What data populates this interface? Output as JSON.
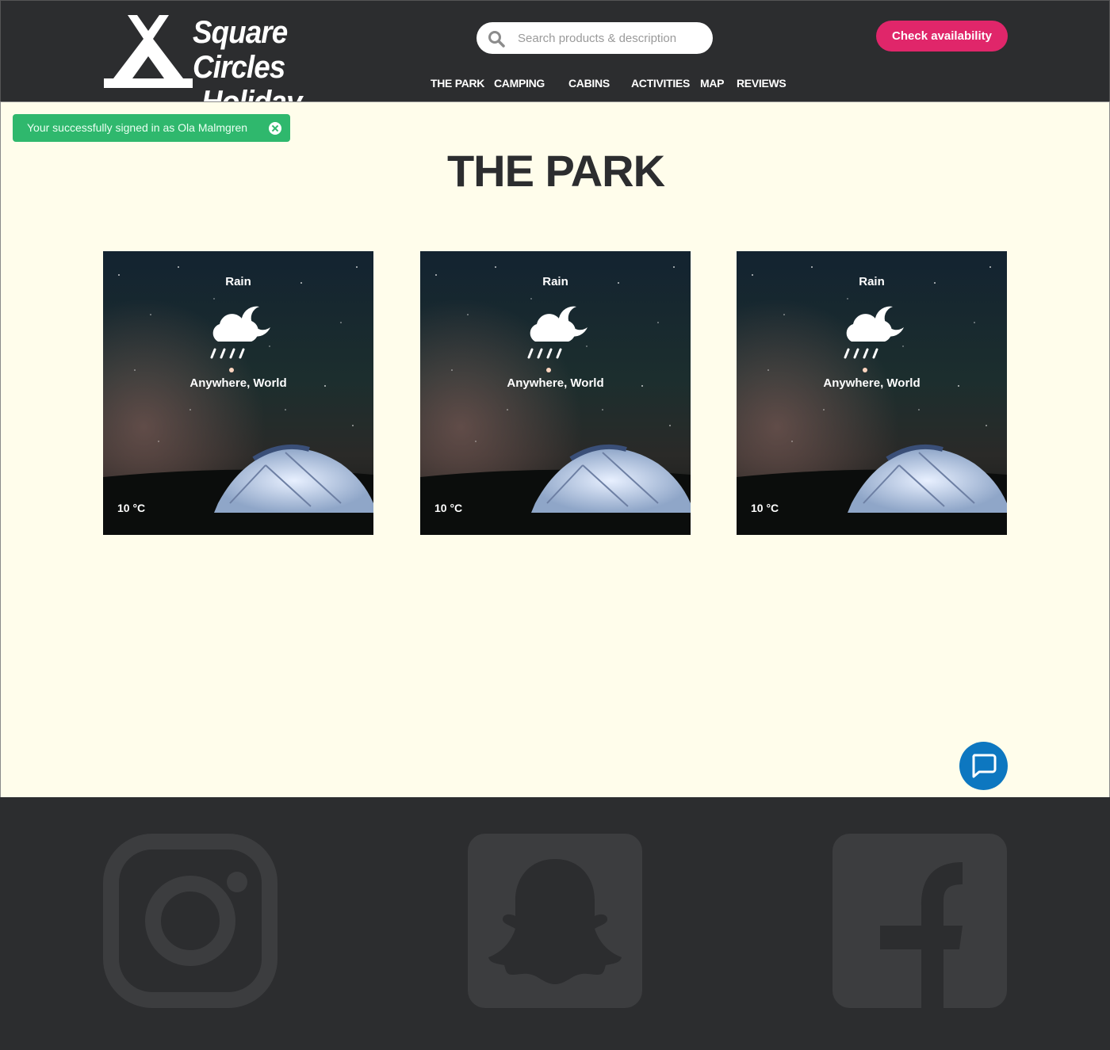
{
  "header": {
    "logo": {
      "line1": "Square Circles",
      "line2": "Holiday Park"
    },
    "search": {
      "placeholder": "Search products & description"
    },
    "cta_label": "Check availability",
    "nav": [
      {
        "label": "THE PARK"
      },
      {
        "label": "CAMPING"
      },
      {
        "label": "CABINS"
      },
      {
        "label": "ACTIVITIES"
      },
      {
        "label": "MAP"
      },
      {
        "label": "REVIEWS"
      }
    ]
  },
  "notification": {
    "message": "Your successfully signed in as Ola Malmgren"
  },
  "page_title": "THE PARK",
  "weather_cards": [
    {
      "condition": "Rain",
      "location": "Anywhere, World",
      "temperature": "10 °C",
      "icon": "rain-night-icon"
    },
    {
      "condition": "Rain",
      "location": "Anywhere, World",
      "temperature": "10 °C",
      "icon": "rain-night-icon"
    },
    {
      "condition": "Rain",
      "location": "Anywhere, World",
      "temperature": "10 °C",
      "icon": "rain-night-icon"
    }
  ],
  "footer": {
    "social": [
      {
        "icon": "instagram-icon"
      },
      {
        "icon": "snapchat-icon"
      },
      {
        "icon": "facebook-icon"
      }
    ]
  },
  "colors": {
    "header_bg": "#2c2d2f",
    "page_bg": "#fffdeb",
    "accent": "#e0266a",
    "success": "#2fb86d",
    "chat": "#0d77c0"
  }
}
